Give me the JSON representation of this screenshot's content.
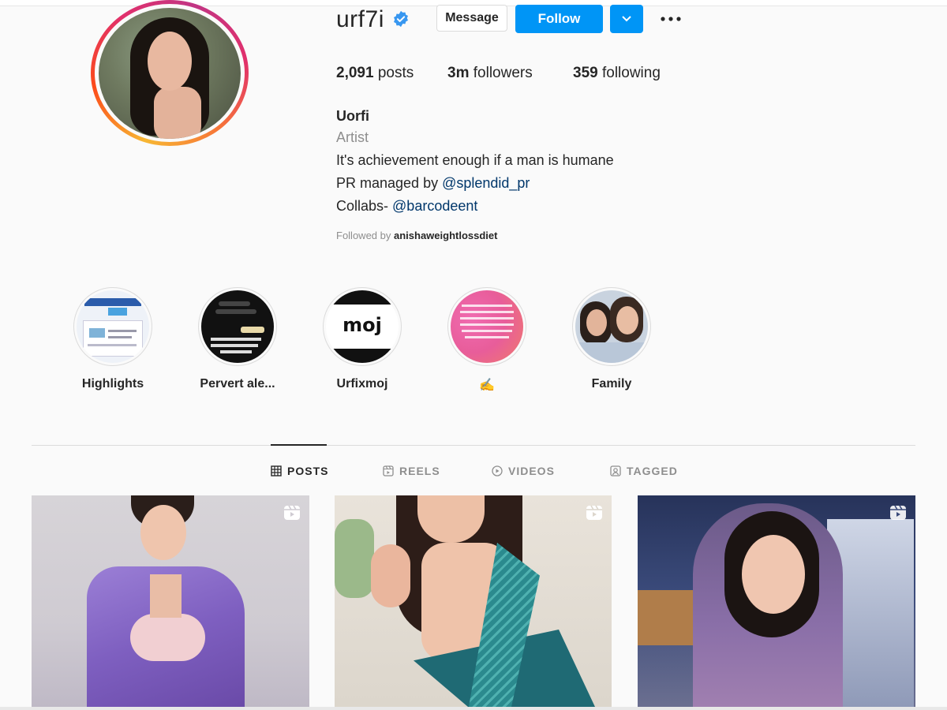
{
  "profile": {
    "username": "urf7i",
    "buttons": {
      "message": "Message",
      "follow": "Follow"
    },
    "stats": {
      "posts_count": "2,091",
      "posts_label": "posts",
      "followers_count": "3m",
      "followers_label": "followers",
      "following_count": "359",
      "following_label": "following"
    },
    "bio": {
      "name": "Uorfi",
      "category": "Artist",
      "line1": "It's achievement enough if a man is humane",
      "line2_prefix": "PR managed by ",
      "line2_link": "@splendid_pr",
      "line3_prefix": "Collabs- ",
      "line3_link": "@barcodeent",
      "followed_prefix": "Followed by ",
      "followed_user": "anishaweightlossdiet"
    }
  },
  "highlights": [
    {
      "label": "Highlights"
    },
    {
      "label": "Pervert ale..."
    },
    {
      "label": "Urfixmoj",
      "cover_text": "moj"
    },
    {
      "label": "✍️"
    },
    {
      "label": "Family"
    }
  ],
  "tabs": [
    {
      "label": "POSTS",
      "icon": "grid-icon",
      "active": true
    },
    {
      "label": "REELS",
      "icon": "reels-icon"
    },
    {
      "label": "VIDEOS",
      "icon": "play-icon"
    },
    {
      "label": "TAGGED",
      "icon": "tag-person-icon"
    }
  ],
  "colors": {
    "accent": "#0095f6",
    "link": "#00376b",
    "muted": "#8e8e8e"
  }
}
